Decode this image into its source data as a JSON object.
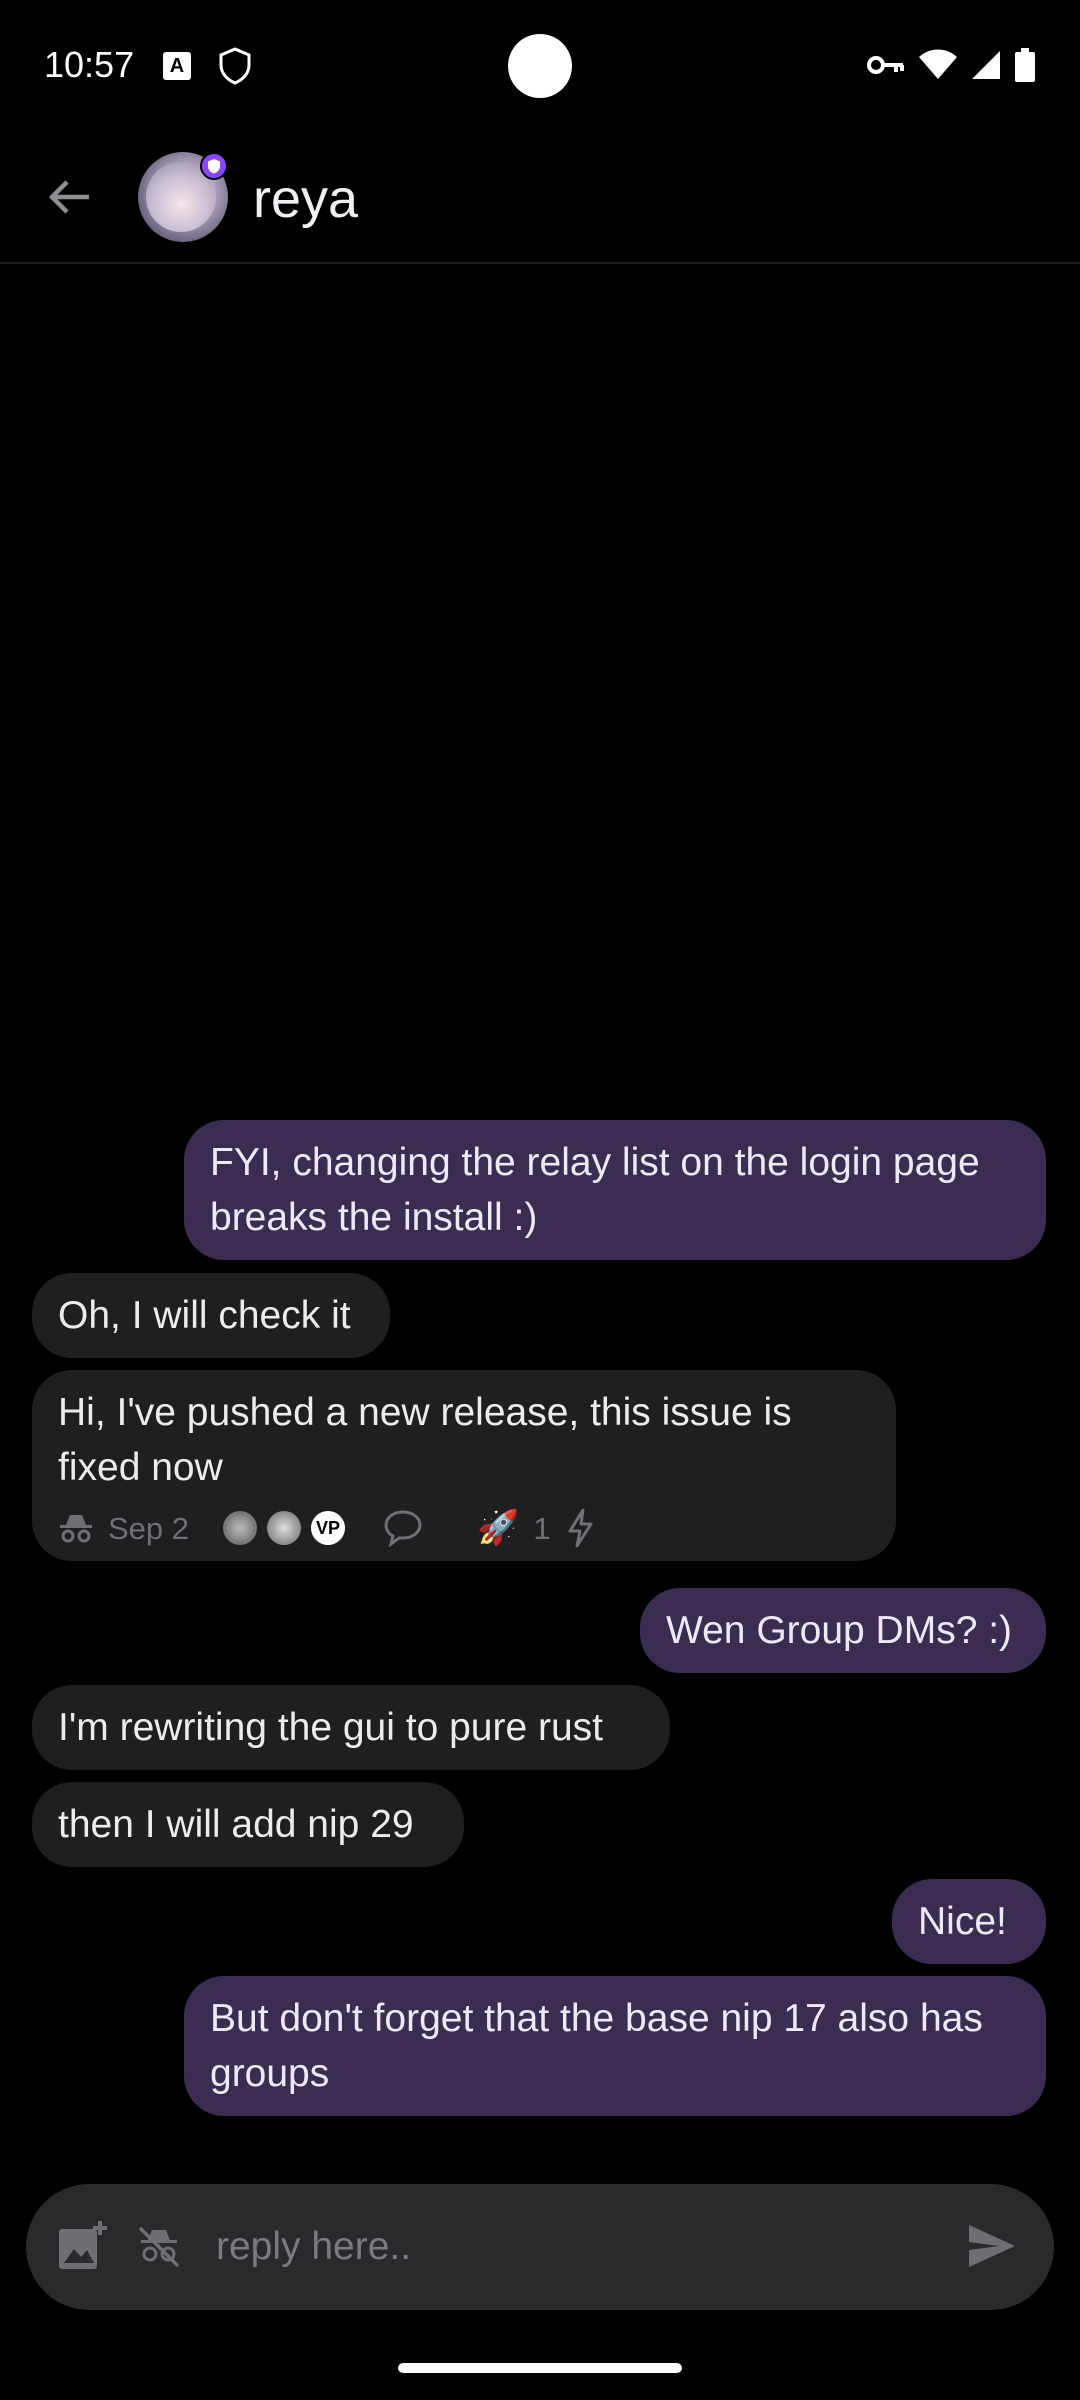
{
  "status_bar": {
    "time": "10:57",
    "a_icon": "A"
  },
  "header": {
    "contact_name": "reya"
  },
  "messages": [
    {
      "direction": "out",
      "text": "FYI, changing the relay list on the login page breaks the install :)"
    },
    {
      "direction": "in",
      "text": "Oh, I will check it"
    },
    {
      "direction": "in",
      "text": "Hi, I've pushed a new release, this issue is fixed now",
      "meta": {
        "date": "Sep 2",
        "vp_badge": "VP",
        "reaction_emoji": "🚀",
        "reaction_count": "1"
      }
    },
    {
      "direction": "out",
      "text": "Wen Group DMs? :)"
    },
    {
      "direction": "in",
      "text": "I'm rewriting the gui to pure rust"
    },
    {
      "direction": "in",
      "text": "then I will add nip 29"
    },
    {
      "direction": "out",
      "text": "Nice!"
    },
    {
      "direction": "out",
      "text": "But don't forget that the base nip 17 also has groups"
    }
  ],
  "composer": {
    "placeholder": "reply here.."
  },
  "colors": {
    "outgoing_bubble": "#3b2c52",
    "incoming_bubble": "#1f1f21",
    "badge": "#8b45ff",
    "background": "#000000"
  },
  "icons": [
    "back-arrow-icon",
    "verified-badge-icon",
    "incognito-icon",
    "reply-icon",
    "zap-icon",
    "add-image-icon",
    "incognito-off-icon",
    "send-icon",
    "vpn-key-icon",
    "wifi-icon",
    "signal-icon",
    "battery-icon"
  ]
}
